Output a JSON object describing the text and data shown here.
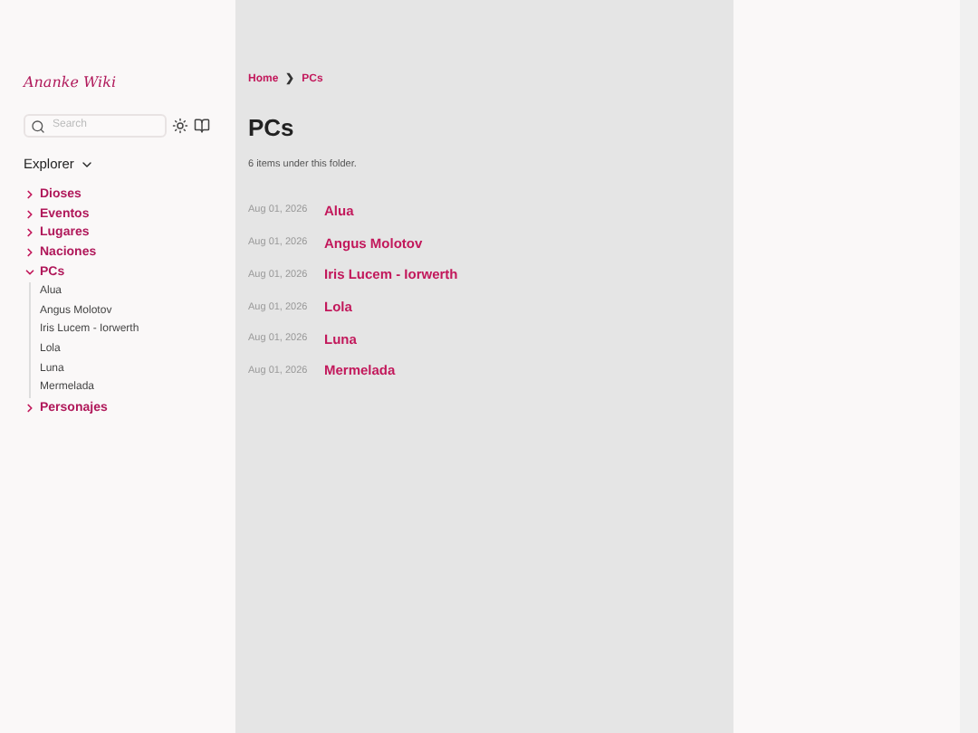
{
  "site_title": "Ananke Wiki",
  "search": {
    "placeholder": "Search"
  },
  "explorer": {
    "title": "Explorer",
    "expanded": true
  },
  "tree": [
    {
      "label": "Dioses",
      "expanded": false
    },
    {
      "label": "Eventos",
      "expanded": false
    },
    {
      "label": "Lugares",
      "expanded": false
    },
    {
      "label": "Naciones",
      "expanded": false
    },
    {
      "label": "PCs",
      "expanded": true,
      "children": [
        {
          "label": "Alua"
        },
        {
          "label": "Angus Molotov"
        },
        {
          "label": "Iris Lucem - Iorwerth"
        },
        {
          "label": "Lola"
        },
        {
          "label": "Luna"
        },
        {
          "label": "Mermelada"
        }
      ]
    },
    {
      "label": "Personajes",
      "expanded": false
    }
  ],
  "breadcrumbs": [
    "Home",
    "PCs"
  ],
  "breadcrumb_separator": "❯",
  "page_title": "PCs",
  "summary": "6 items under this folder.",
  "items": [
    {
      "date": "Aug 01, 2026",
      "title": "Alua"
    },
    {
      "date": "Aug 01, 2026",
      "title": "Angus Molotov"
    },
    {
      "date": "Aug 01, 2026",
      "title": "Iris Lucem - Iorwerth"
    },
    {
      "date": "Aug 01, 2026",
      "title": "Lola"
    },
    {
      "date": "Aug 01, 2026",
      "title": "Luna"
    },
    {
      "date": "Aug 01, 2026",
      "title": "Mermelada"
    }
  ]
}
